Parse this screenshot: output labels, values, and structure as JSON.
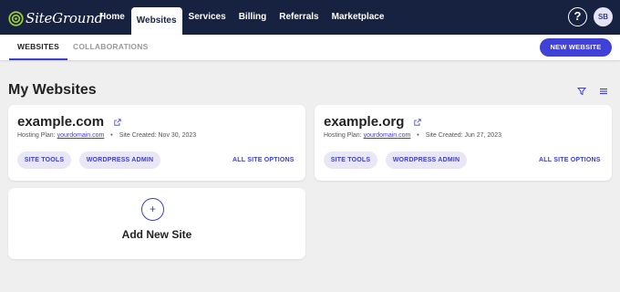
{
  "brand": {
    "name": "SiteGround",
    "accent": "#3f41d8",
    "nav_bg": "#172240"
  },
  "nav": {
    "items": [
      {
        "label": "Home"
      },
      {
        "label": "Websites"
      },
      {
        "label": "Services"
      },
      {
        "label": "Billing"
      },
      {
        "label": "Referrals"
      },
      {
        "label": "Marketplace"
      }
    ],
    "active": "Websites",
    "help_label": "?",
    "avatar_initials": "SB"
  },
  "subnav": {
    "tabs": [
      {
        "label": "WEBSITES"
      },
      {
        "label": "COLLABORATIONS"
      }
    ],
    "new_website_label": "NEW WEBSITE"
  },
  "page": {
    "title": "My Websites",
    "icons": [
      "filter-icon",
      "list-menu-icon"
    ]
  },
  "sites": [
    {
      "domain": "example.com",
      "plan_label": "Hosting Plan:",
      "plan_value": "yourdomain.com",
      "created": "Site Created: Nov 30, 2023",
      "site_tools": "SITE TOOLS",
      "wp_admin": "WORDPRESS ADMIN",
      "options": "ALL SITE OPTIONS"
    },
    {
      "domain": "example.org",
      "plan_label": "Hosting Plan:",
      "plan_value": "yourdomain.com",
      "created": "Site Created: Jun 27, 2023",
      "site_tools": "SITE TOOLS",
      "wp_admin": "WORDPRESS ADMIN",
      "options": "ALL SITE OPTIONS"
    }
  ],
  "add_site": {
    "icon": "+",
    "label": "Add New Site"
  }
}
